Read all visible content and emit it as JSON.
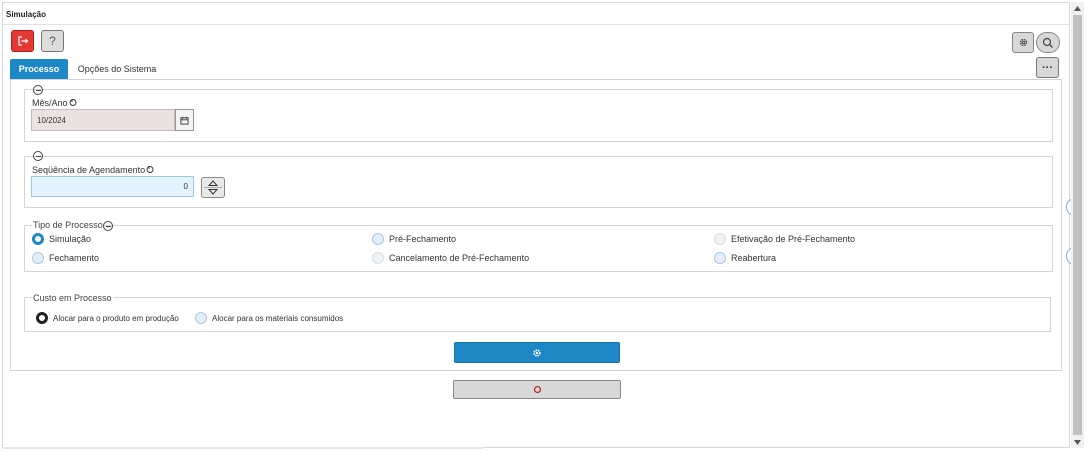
{
  "window": {
    "title": "Simulação"
  },
  "toolbar": {
    "help_label": "?",
    "more_label": "···"
  },
  "tabs": [
    {
      "label": "Processo",
      "active": true
    },
    {
      "label": "Opções do Sistema",
      "active": false
    }
  ],
  "mes_ano": {
    "label": "Mês/Ano",
    "value": "10/2024"
  },
  "sequencia": {
    "label": "Seqüência de Agendamento",
    "value": "0"
  },
  "tipo_processo": {
    "label": "Tipo de Processo",
    "options": [
      {
        "label": "Simulação",
        "selected": true
      },
      {
        "label": "Pré-Fechamento",
        "selected": false
      },
      {
        "label": "Efetivação de Pré-Fechamento",
        "selected": false
      },
      {
        "label": "Fechamento",
        "selected": false
      },
      {
        "label": "Cancelamento de Pré-Fechamento",
        "selected": false
      },
      {
        "label": "Reabertura",
        "selected": false
      }
    ]
  },
  "custo_processo": {
    "label": "Custo em Processo",
    "options": [
      {
        "label": "Alocar para o produto em produção",
        "selected": true
      },
      {
        "label": "Alocar para os materiais consumidos",
        "selected": false
      }
    ]
  },
  "colors": {
    "accent": "#1e88c7",
    "exit_button": "#e53935",
    "date_field_bg": "#ece1e1",
    "number_field_bg": "#e3f2fd"
  },
  "icons": {
    "exit": "exit-icon",
    "help": "question-icon",
    "settings": "gear-icon",
    "search": "search-icon",
    "more": "ellipsis-icon",
    "calendar": "calendar-icon",
    "stepper": "up-down-stepper-icon",
    "run": "gear-icon",
    "cancel": "circle-icon",
    "scroll_top": "double-chevron-up-icon",
    "scroll_bottom": "double-chevron-down-icon"
  }
}
